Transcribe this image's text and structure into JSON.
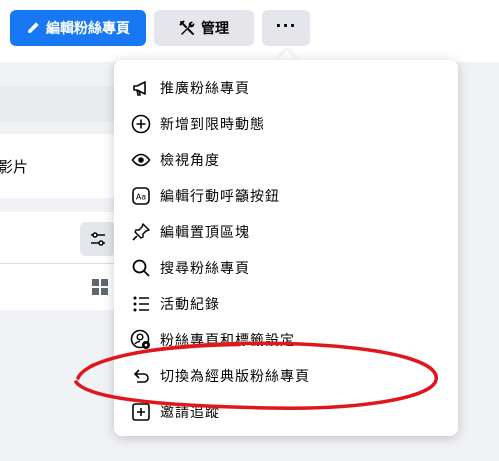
{
  "header": {
    "edit_label": "編輯粉絲專頁",
    "manage_label": "管理",
    "more_label": "···"
  },
  "background": {
    "partial_text": "影片"
  },
  "menu": {
    "items": [
      {
        "label": "推廣粉絲專頁",
        "icon": "megaphone-icon"
      },
      {
        "label": "新增到限時動態",
        "icon": "plus-circle-icon"
      },
      {
        "label": "檢視角度",
        "icon": "eye-icon"
      },
      {
        "label": "編輯行動呼籲按鈕",
        "icon": "aa-button-icon"
      },
      {
        "label": "編輯置頂區塊",
        "icon": "pin-icon"
      },
      {
        "label": "搜尋粉絲專頁",
        "icon": "search-icon"
      },
      {
        "label": "活動紀錄",
        "icon": "list-icon"
      },
      {
        "label": "粉絲專頁和標籤設定",
        "icon": "settings-user-icon"
      },
      {
        "label": "切換為經典版粉絲專頁",
        "icon": "undo-arrow-icon"
      },
      {
        "label": "邀請追蹤",
        "icon": "plus-square-icon"
      }
    ]
  },
  "colors": {
    "primary": "#1877f2",
    "annotation": "#e0161b"
  }
}
